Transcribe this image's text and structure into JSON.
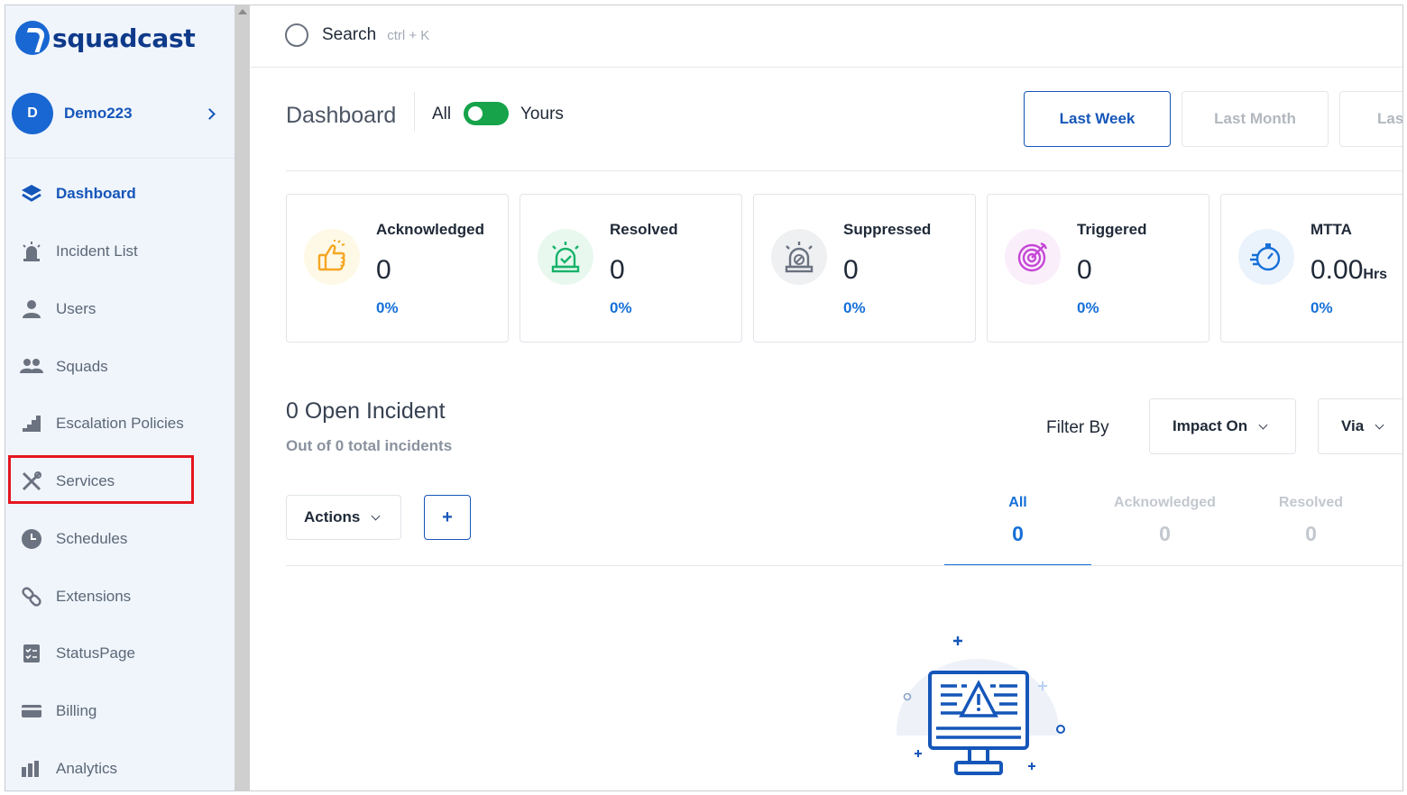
{
  "app": {
    "brand": "squadcast",
    "brand_color": "#1967d2"
  },
  "org": {
    "avatar_letter": "D",
    "name": "Demo223"
  },
  "sidebar": {
    "items": [
      {
        "label": "Dashboard",
        "icon": "layers-icon",
        "active": true
      },
      {
        "label": "Incident List",
        "icon": "siren-icon"
      },
      {
        "label": "Users",
        "icon": "user-icon"
      },
      {
        "label": "Squads",
        "icon": "users-icon"
      },
      {
        "label": "Escalation Policies",
        "icon": "stairs-icon"
      },
      {
        "label": "Services",
        "icon": "tools-icon",
        "highlighted": true
      },
      {
        "label": "Schedules",
        "icon": "clock-icon"
      },
      {
        "label": "Extensions",
        "icon": "link-icon"
      },
      {
        "label": "StatusPage",
        "icon": "checklist-icon"
      },
      {
        "label": "Billing",
        "icon": "card-icon"
      },
      {
        "label": "Analytics",
        "icon": "bar-chart-icon"
      }
    ]
  },
  "search": {
    "label": "Search",
    "hint": "ctrl + K"
  },
  "dashboard": {
    "title": "Dashboard",
    "toggle_left": "All",
    "toggle_right": "Yours",
    "ranges": [
      "Last Week",
      "Last Month",
      "Las"
    ],
    "active_range": "Last Week"
  },
  "stats": [
    {
      "title": "Acknowledged",
      "value": "0",
      "pct": "0%",
      "icon": "thumbs-up-icon"
    },
    {
      "title": "Resolved",
      "value": "0",
      "pct": "0%",
      "icon": "siren-check-icon"
    },
    {
      "title": "Suppressed",
      "value": "0",
      "pct": "0%",
      "icon": "siren-muted-icon"
    },
    {
      "title": "Triggered",
      "value": "0",
      "pct": "0%",
      "icon": "target-icon"
    },
    {
      "title": "MTTA",
      "value": "0.00",
      "unit": "Hrs",
      "pct": "0%",
      "icon": "stopwatch-icon"
    }
  ],
  "incidents": {
    "title": "0 Open Incident",
    "subtitle": "Out of 0 total incidents",
    "filter_label": "Filter By",
    "filters": [
      "Impact On",
      "Via"
    ],
    "actions_label": "Actions",
    "add_label": "+",
    "tabs": [
      {
        "label": "All",
        "count": "0",
        "active": true
      },
      {
        "label": "Acknowledged",
        "count": "0"
      },
      {
        "label": "Resolved",
        "count": "0"
      }
    ]
  }
}
